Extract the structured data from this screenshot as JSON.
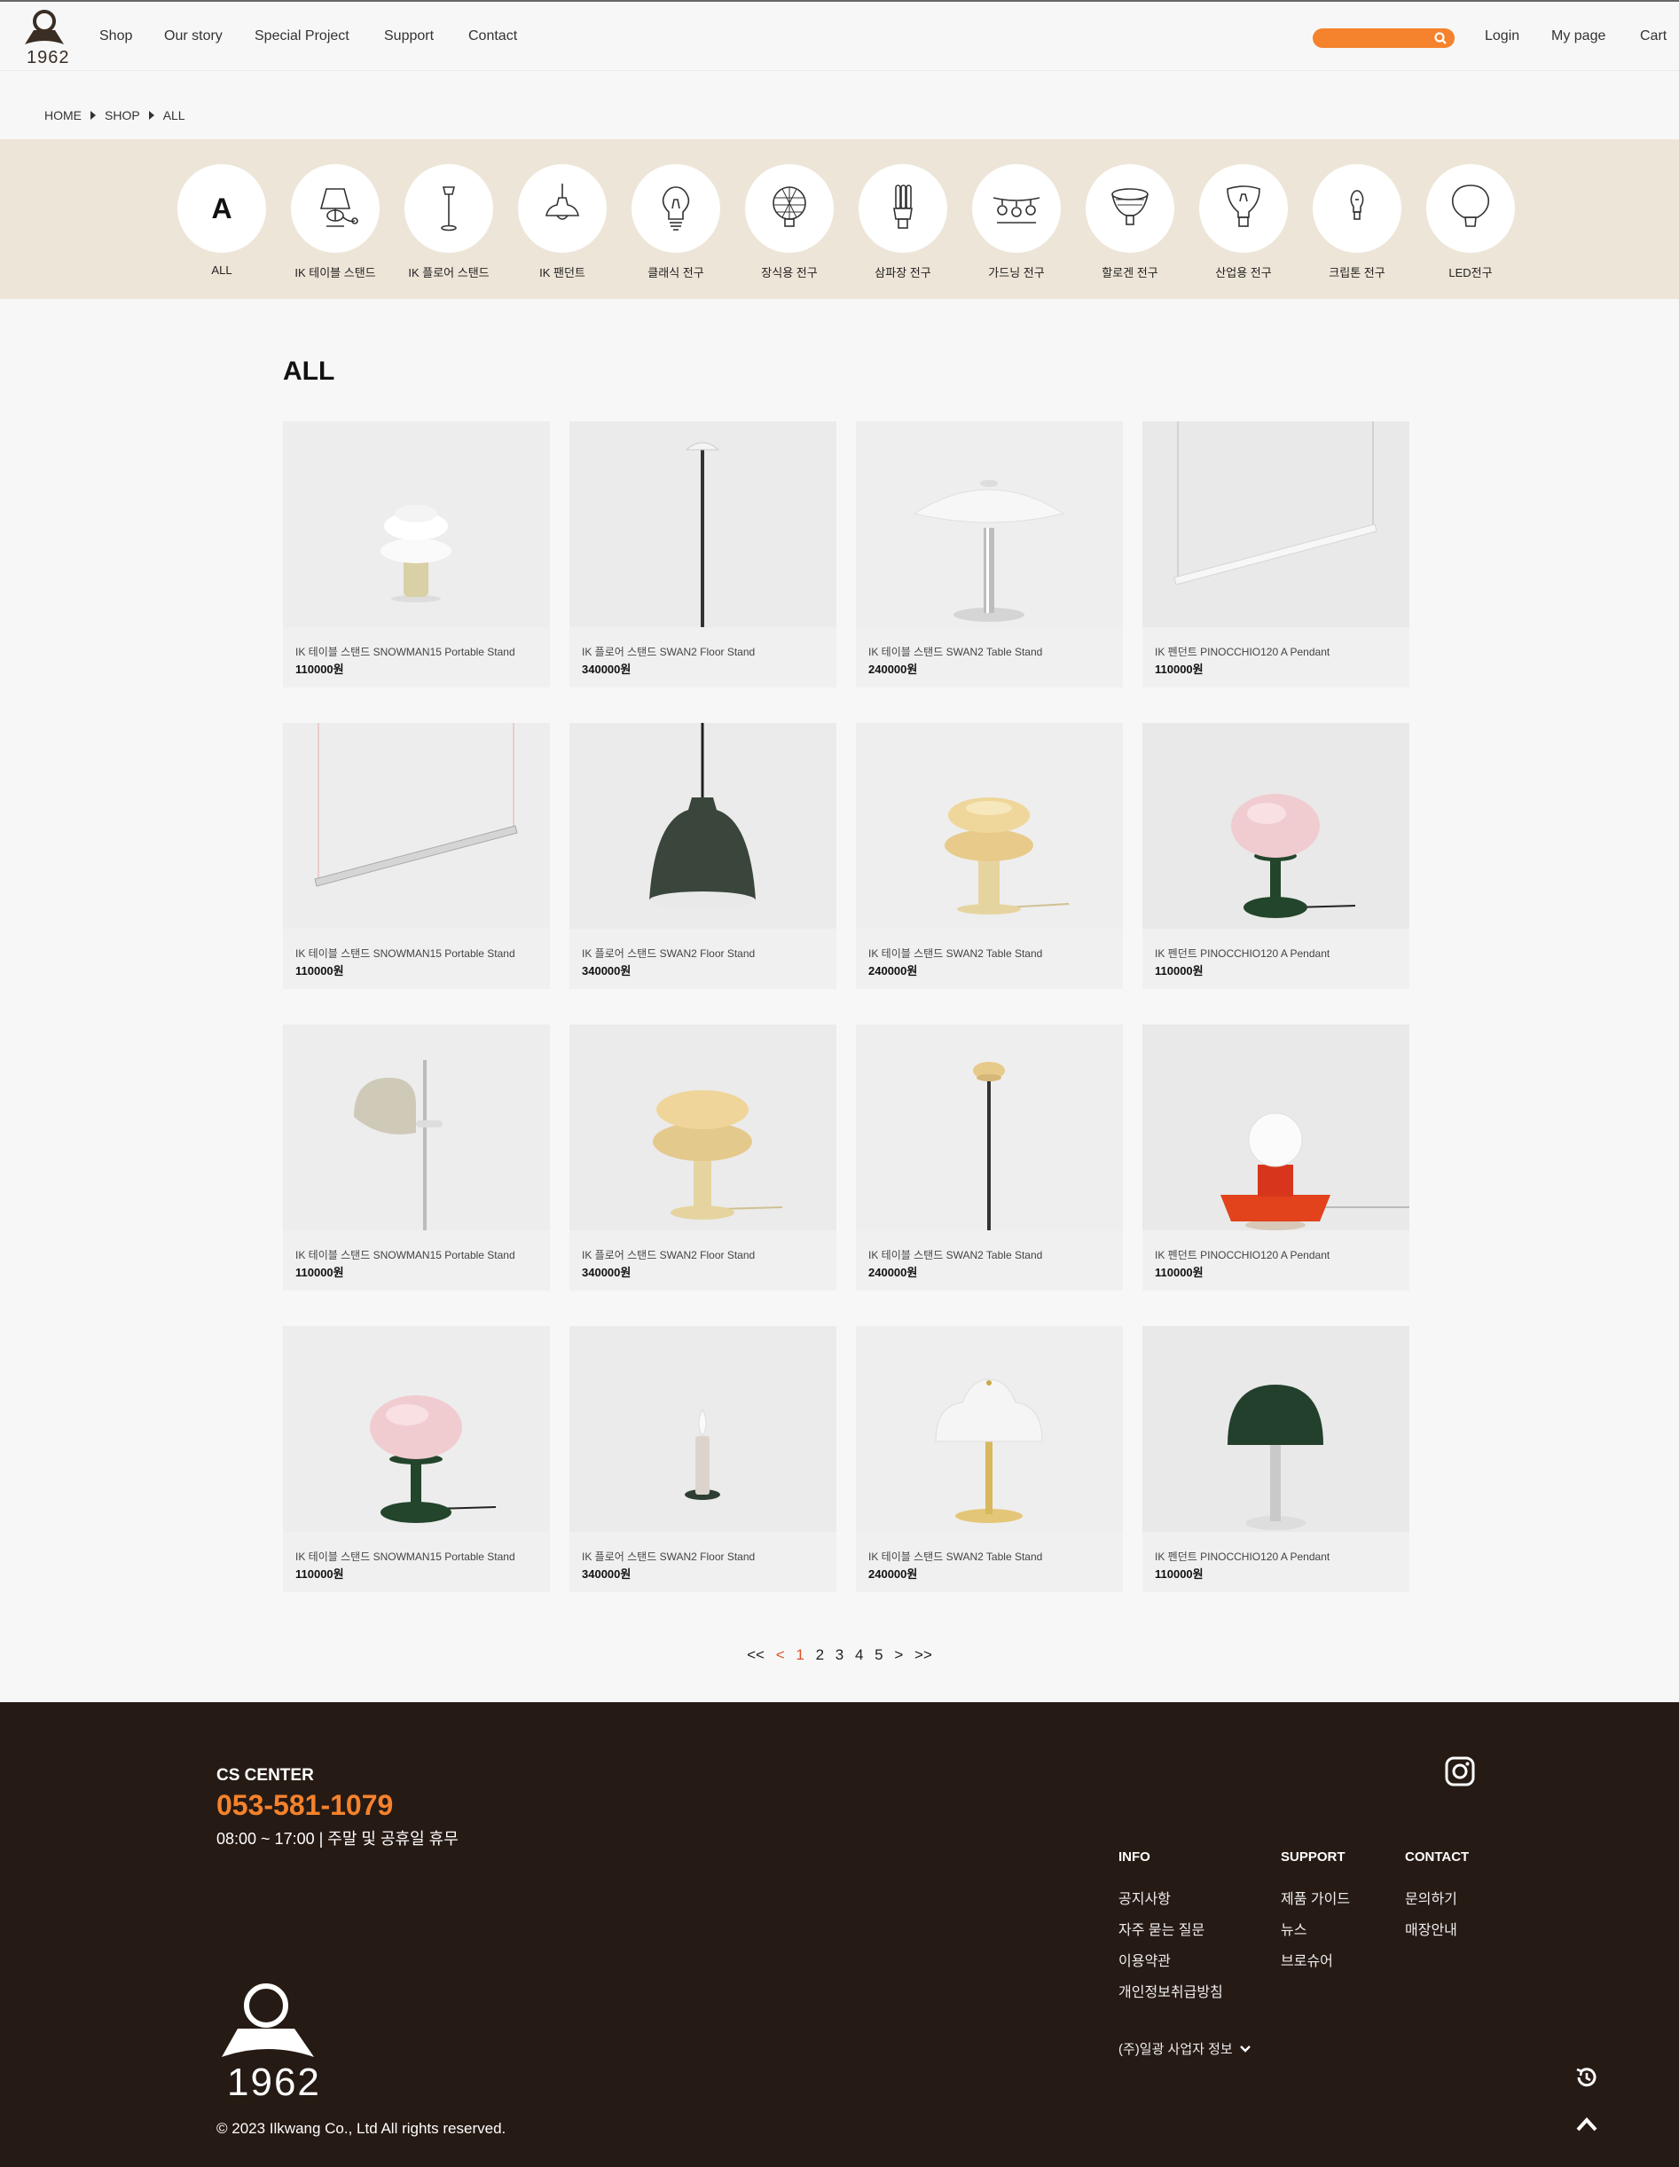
{
  "header": {
    "logo": "1962",
    "nav": [
      "Shop",
      "Our story",
      "Special Project",
      "Support",
      "Contact"
    ],
    "search_placeholder": "",
    "user": [
      "Login",
      "My page",
      "Cart"
    ]
  },
  "breadcrumb": [
    "HOME",
    "SHOP",
    "ALL"
  ],
  "categories": [
    {
      "label": "ALL",
      "icon": "letter-a",
      "letter": "A"
    },
    {
      "label": "IK 테이블 스탠드",
      "icon": "table-lamp-icon"
    },
    {
      "label": "IK 플로어 스탠드",
      "icon": "floor-lamp-icon"
    },
    {
      "label": "IK 팬던트",
      "icon": "pendant-lamp-icon"
    },
    {
      "label": "클래식 전구",
      "icon": "classic-bulb-icon"
    },
    {
      "label": "장식용 전구",
      "icon": "decorative-bulb-icon"
    },
    {
      "label": "삼파장 전구",
      "icon": "cfl-bulb-icon"
    },
    {
      "label": "가드닝 전구",
      "icon": "string-bulb-icon"
    },
    {
      "label": "할로겐 전구",
      "icon": "halogen-bulb-icon"
    },
    {
      "label": "산업용 전구",
      "icon": "industrial-bulb-icon"
    },
    {
      "label": "크립톤 전구",
      "icon": "krypton-bulb-icon"
    },
    {
      "label": "LED전구",
      "icon": "led-bulb-icon"
    }
  ],
  "page_title": "ALL",
  "products": [
    {
      "name": "IK 테이블 스탠드 SNOWMAN15 Portable Stand",
      "price": "110000원",
      "img": "snowman-white"
    },
    {
      "name": "IK 플로어 스탠드 SWAN2 Floor Stand",
      "price": "340000원",
      "img": "floor-swan"
    },
    {
      "name": "IK 테이블 스탠드 SWAN2 Table Stand",
      "price": "240000원",
      "img": "table-swan"
    },
    {
      "name": "IK 펜던트 PINOCCHIO120 A Pendant",
      "price": "110000원",
      "img": "linear-pendant"
    },
    {
      "name": "IK 테이블 스탠드 SNOWMAN15 Portable Stand",
      "price": "110000원",
      "img": "linear-pendant-2"
    },
    {
      "name": "IK 플로어 스탠드 SWAN2 Floor Stand",
      "price": "340000원",
      "img": "green-dome-pendant"
    },
    {
      "name": "IK 테이블 스탠드 SWAN2 Table Stand",
      "price": "240000원",
      "img": "snowman-yellow"
    },
    {
      "name": "IK 펜던트 PINOCCHIO120 A Pendant",
      "price": "110000원",
      "img": "pink-green-lamp"
    },
    {
      "name": "IK 테이블 스탠드 SNOWMAN15 Portable Stand",
      "price": "110000원",
      "img": "grey-desk-lamp"
    },
    {
      "name": "IK 플로어 스탠드 SWAN2 Floor Stand",
      "price": "340000원",
      "img": "snowman-yellow-2"
    },
    {
      "name": "IK 테이블 스탠드 SWAN2 Table Stand",
      "price": "240000원",
      "img": "floor-yellow-top"
    },
    {
      "name": "IK 펜던트 PINOCCHIO120 A Pendant",
      "price": "110000원",
      "img": "orange-bulb-lamp"
    },
    {
      "name": "IK 테이블 스탠드 SNOWMAN15 Portable Stand",
      "price": "110000원",
      "img": "pink-green-lamp-2"
    },
    {
      "name": "IK 플로어 스탠드 SWAN2 Floor Stand",
      "price": "340000원",
      "img": "candle-lamp"
    },
    {
      "name": "IK 테이블 스탠드 SWAN2 Table Stand",
      "price": "240000원",
      "img": "white-gold-lamp"
    },
    {
      "name": "IK 펜던트 PINOCCHIO120 A Pendant",
      "price": "110000원",
      "img": "green-mushroom-lamp"
    }
  ],
  "pagination": {
    "first": "<<",
    "prev": "<",
    "pages": [
      "1",
      "2",
      "3",
      "4",
      "5"
    ],
    "current": "1",
    "next": ">",
    "last": ">>"
  },
  "footer": {
    "cs_title": "CS CENTER",
    "phone": "053-581-1079",
    "hours": "08:00 ~ 17:00 | 주말 및 공휴일 휴무",
    "info_title": "INFO",
    "info": [
      "공지사항",
      "자주 묻는 질문",
      "이용약관",
      "개인정보취급방침"
    ],
    "support_title": "SUPPORT",
    "support": [
      "제품 가이드",
      "뉴스",
      "브로슈어"
    ],
    "contact_title": "CONTACT",
    "contact": [
      "문의하기",
      "매장안내"
    ],
    "company": "(주)일광 사업자 정보",
    "logo": "1962",
    "copyright": "© 2023 Ilkwang Co., Ltd All rights reserved."
  },
  "colors": {
    "accent": "#f5822c",
    "footer_bg": "#261a14",
    "category_bg": "#ede5d7"
  }
}
